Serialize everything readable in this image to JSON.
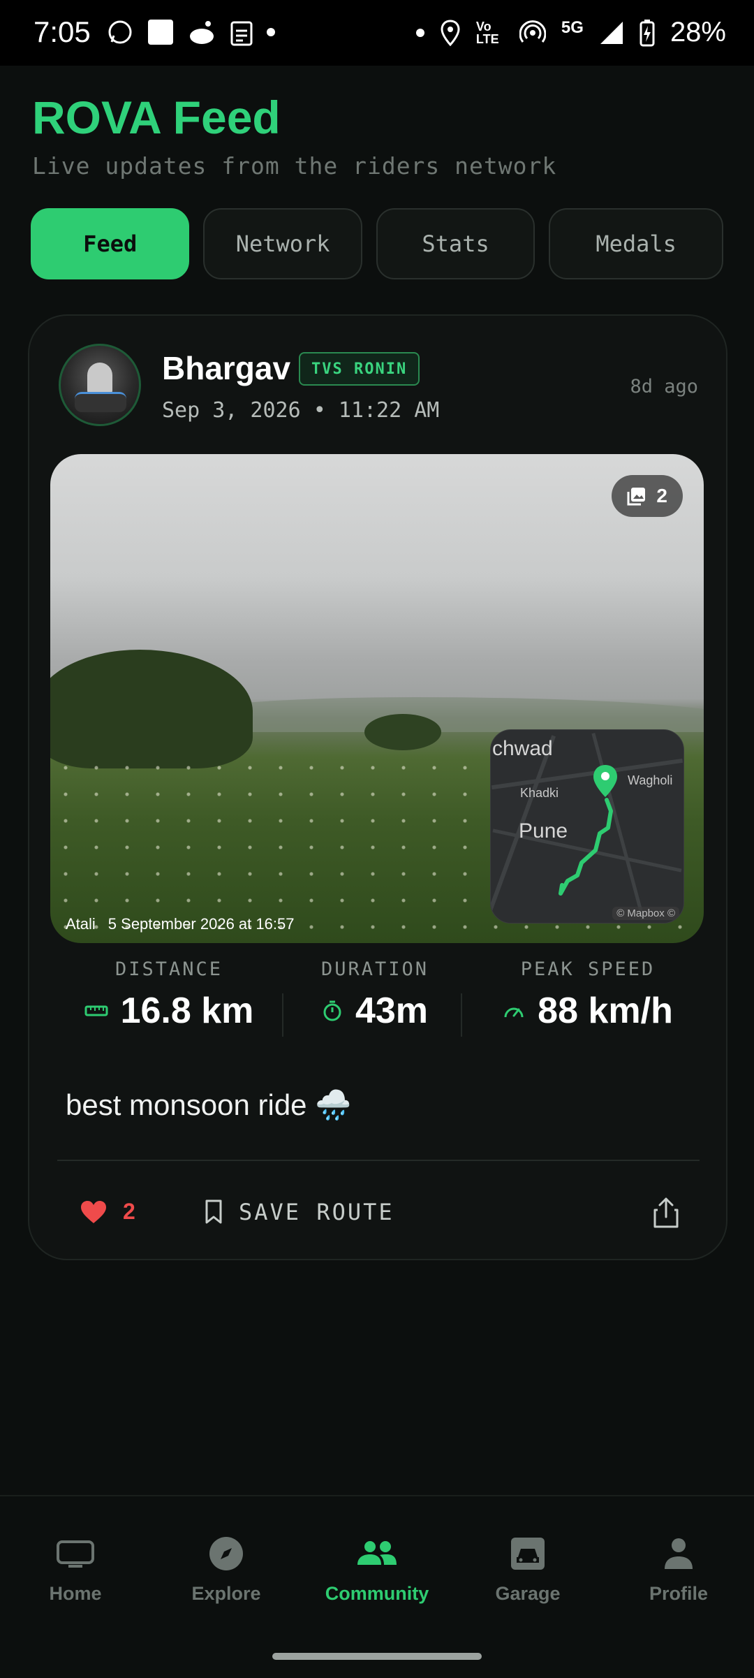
{
  "status_bar": {
    "time": "7:05",
    "network": "5G",
    "volte": "Vo LTE",
    "battery": "28%"
  },
  "header": {
    "title": "ROVA Feed",
    "subtitle": "Live updates from the riders network"
  },
  "tabs": [
    {
      "label": "Feed",
      "active": true
    },
    {
      "label": "Network",
      "active": false
    },
    {
      "label": "Stats",
      "active": false
    },
    {
      "label": "Medals",
      "active": false
    }
  ],
  "post": {
    "user_name": "Bhargav",
    "bike_badge": "TVS RONIN",
    "date": "Sep 3, 2026 • 11:22 AM",
    "time_ago": "8d ago",
    "photo": {
      "count": "2",
      "location": "Atali",
      "timestamp": "5 September 2026 at 16:57"
    },
    "map": {
      "labels": [
        "chwad",
        "Khadki",
        "Wagholi",
        "Pune"
      ],
      "credit": "© Mapbox ©"
    },
    "stats": [
      {
        "label": "DISTANCE",
        "value": "16.8 km",
        "icon": "ruler-icon"
      },
      {
        "label": "DURATION",
        "value": "43m",
        "icon": "timer-icon"
      },
      {
        "label": "PEAK SPEED",
        "value": "88 km/h",
        "icon": "speedometer-icon"
      }
    ],
    "caption": "best monsoon ride 🌧️",
    "likes": "2",
    "save_label": "SAVE ROUTE"
  },
  "bottom_nav": [
    {
      "label": "Home",
      "icon": "tv-icon"
    },
    {
      "label": "Explore",
      "icon": "compass-icon"
    },
    {
      "label": "Community",
      "icon": "people-icon",
      "active": true
    },
    {
      "label": "Garage",
      "icon": "car-icon"
    },
    {
      "label": "Profile",
      "icon": "person-icon"
    }
  ],
  "colors": {
    "accent": "#2ecc71",
    "background": "#0c0f0e",
    "card": "#101312",
    "like": "#ef4b4b"
  }
}
